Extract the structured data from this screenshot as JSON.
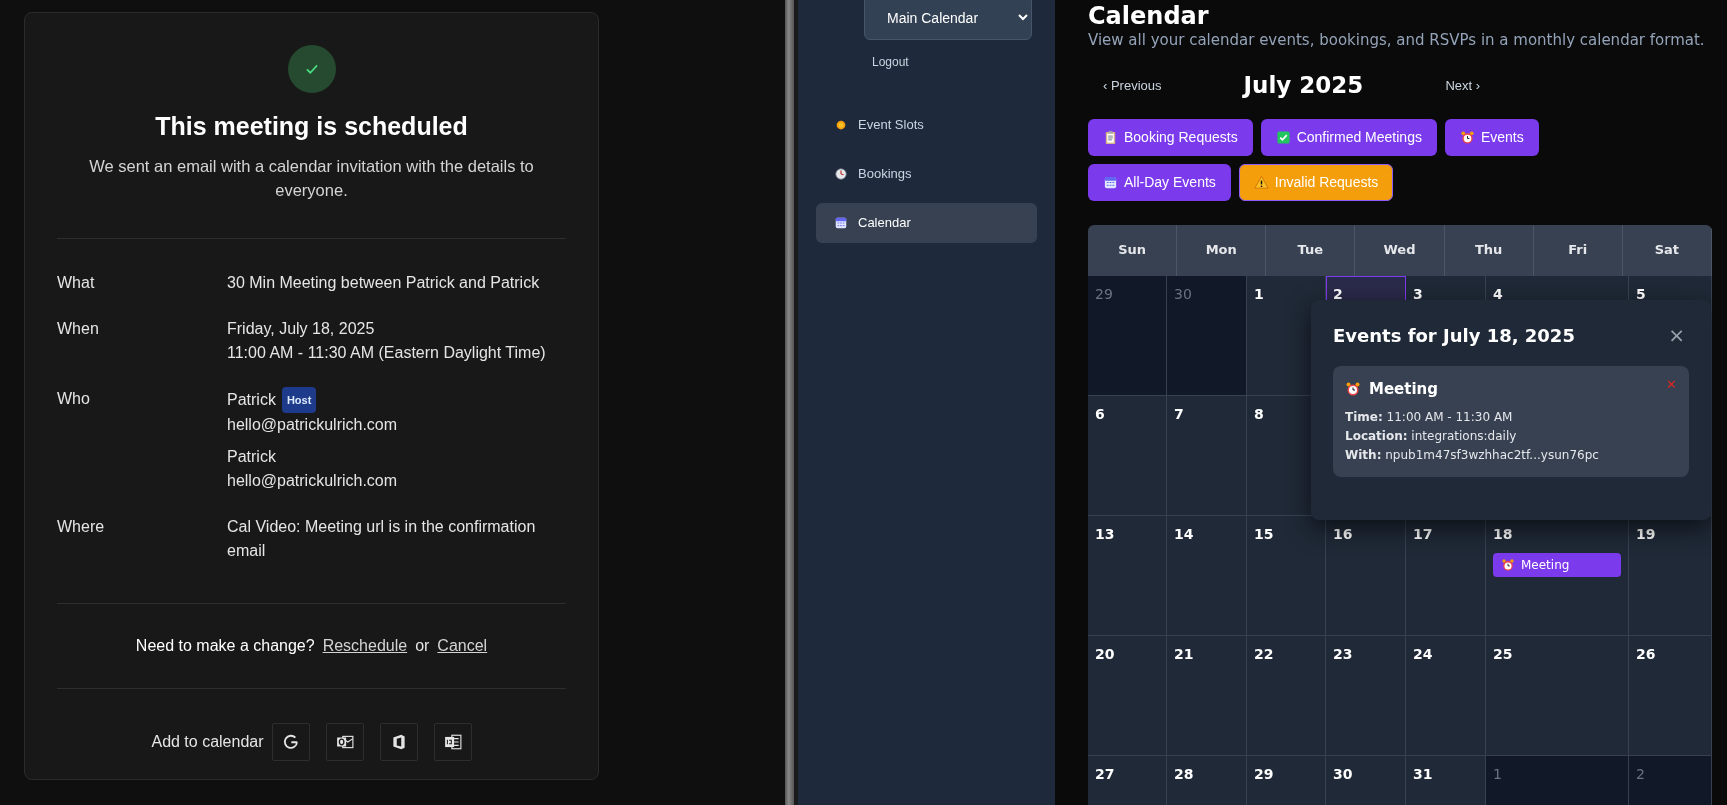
{
  "booking": {
    "title": "This meeting is scheduled",
    "subtitle": "We sent an email with a calendar invitation with the details to everyone.",
    "details": [
      {
        "kind": "text",
        "label": "What",
        "lines": [
          "30 Min Meeting between Patrick and Patrick"
        ]
      },
      {
        "kind": "text",
        "label": "When",
        "lines": [
          "Friday, July 18, 2025",
          "11:00 AM - 11:30 AM (Eastern Daylight Time)"
        ]
      },
      {
        "kind": "attendees",
        "label": "Who",
        "attendees": [
          {
            "name": "Patrick",
            "badge": "Host",
            "email": "hello@patrickulrich.com"
          },
          {
            "name": "Patrick",
            "email": "hello@patrickulrich.com"
          }
        ]
      },
      {
        "kind": "text",
        "label": "Where",
        "lines": [
          "Cal Video: Meeting url is in the confirmation email"
        ]
      }
    ],
    "change": {
      "prompt": "Need to make a change?",
      "reschedule": "Reschedule",
      "or": "or",
      "cancel": "Cancel"
    },
    "add_to_calendar": {
      "label": "Add to calendar",
      "buttons": [
        {
          "kind": "google"
        },
        {
          "kind": "outlook"
        },
        {
          "kind": "office"
        },
        {
          "kind": "ics"
        }
      ]
    }
  },
  "sidebar": {
    "calendar_select": "Main Calendar",
    "logout": "Logout",
    "items": [
      {
        "kind": "sun",
        "label": "Event Slots",
        "selected": false
      },
      {
        "kind": "clock",
        "label": "Bookings",
        "selected": false
      },
      {
        "kind": "calendar",
        "label": "Calendar",
        "selected": true
      }
    ]
  },
  "main": {
    "heading": "Calendar",
    "subtitle": "View all your calendar events, bookings, and RSVPs in a monthly calendar format.",
    "previous": "‹ Previous",
    "month": "July 2025",
    "next": "Next ›",
    "filters": [
      {
        "kind": "clipboard",
        "label": "Booking Requests",
        "color": "#7c3aed"
      },
      {
        "kind": "check",
        "label": "Confirmed Meetings",
        "color": "#7c3aed"
      },
      {
        "kind": "alarm",
        "label": "Events",
        "color": "#7c3aed"
      },
      {
        "kind": "calendar",
        "label": "All-Day Events",
        "color": "#7c3aed"
      },
      {
        "kind": "warning",
        "label": "Invalid Requests",
        "color": "#f59e0b"
      }
    ]
  },
  "calendar": {
    "weekdays": [
      "Sun",
      "Mon",
      "Tue",
      "Wed",
      "Thu",
      "Fri",
      "Sat"
    ],
    "weeks": [
      [
        {
          "day": "29",
          "outside": true,
          "selected": false
        },
        {
          "day": "30",
          "outside": true,
          "selected": false
        },
        {
          "day": "1",
          "outside": false,
          "selected": false
        },
        {
          "day": "2",
          "outside": false,
          "selected": true
        },
        {
          "day": "3",
          "outside": false,
          "selected": false
        },
        {
          "day": "4",
          "outside": false,
          "selected": false
        },
        {
          "day": "5",
          "outside": false,
          "selected": false
        }
      ],
      [
        {
          "day": "6",
          "outside": false,
          "selected": false
        },
        {
          "day": "7",
          "outside": false,
          "selected": false
        },
        {
          "day": "8",
          "outside": false,
          "selected": false
        }
      ],
      [
        {
          "day": "13",
          "outside": false,
          "selected": false
        },
        {
          "day": "14",
          "outside": false,
          "selected": false
        },
        {
          "day": "15",
          "outside": false,
          "selected": false
        },
        {
          "day": "16",
          "outside": false,
          "selected": false
        },
        {
          "day": "17",
          "outside": false,
          "selected": false
        },
        {
          "day": "18",
          "outside": false,
          "selected": false,
          "events": [
            {
              "title": "Meeting"
            }
          ]
        },
        {
          "day": "19",
          "outside": false,
          "selected": false
        }
      ],
      [
        {
          "day": "20",
          "outside": false,
          "selected": false
        },
        {
          "day": "21",
          "outside": false,
          "selected": false
        },
        {
          "day": "22",
          "outside": false,
          "selected": false
        },
        {
          "day": "23",
          "outside": false,
          "selected": false
        },
        {
          "day": "24",
          "outside": false,
          "selected": false
        },
        {
          "day": "25",
          "outside": false,
          "selected": false
        },
        {
          "day": "26",
          "outside": false,
          "selected": false
        }
      ],
      [
        {
          "day": "27",
          "outside": false,
          "selected": false
        },
        {
          "day": "28",
          "outside": false,
          "selected": false
        },
        {
          "day": "29",
          "outside": false,
          "selected": false
        },
        {
          "day": "30",
          "outside": false,
          "selected": false
        },
        {
          "day": "31",
          "outside": false,
          "selected": false
        },
        {
          "day": "1",
          "outside": true,
          "selected": false
        },
        {
          "day": "2",
          "outside": true,
          "selected": false
        }
      ]
    ],
    "popup": {
      "title": "Events for July 18, 2025",
      "close": "×",
      "events": [
        {
          "title": "Meeting",
          "delete": "✕",
          "lines": [
            "**Time:** 11:00 AM - 11:30 AM",
            "**Location:** integrations:daily",
            "**With:** npub1m47sf3wzhhac2tf...ysun76pc"
          ]
        }
      ]
    }
  }
}
